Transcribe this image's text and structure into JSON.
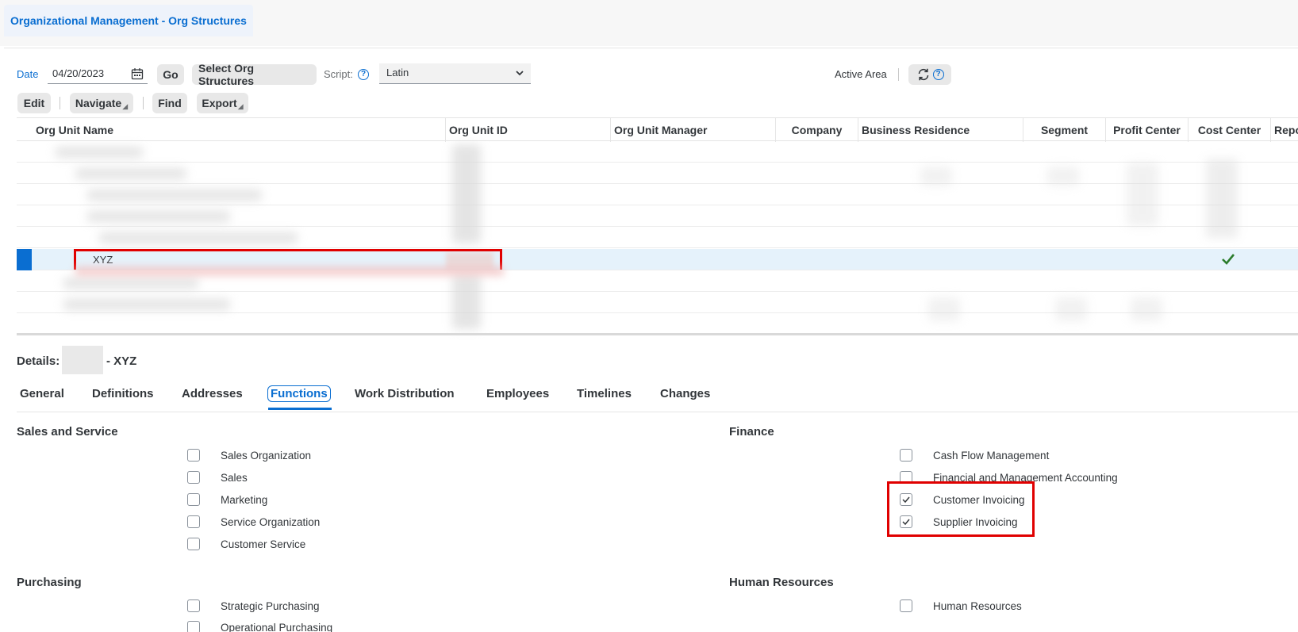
{
  "window": {
    "tab_title": "Organizational Management - Org Structures"
  },
  "toolbar": {
    "date_label": "Date",
    "date_value": "04/20/2023",
    "go_label": "Go",
    "select_org_label": "Select Org Structures",
    "script_label": "Script:",
    "script_value": "Latin",
    "active_area_label": "Active Area",
    "edit_label": "Edit",
    "navigate_label": "Navigate",
    "find_label": "Find",
    "export_label": "Export"
  },
  "table": {
    "columns": [
      "Org Unit Name",
      "Org Unit ID",
      "Org Unit Manager",
      "Company",
      "Business Residence",
      "Segment",
      "Profit Center",
      "Cost Center",
      "Repo"
    ],
    "selected_row": {
      "name": "XYZ",
      "cost_center_checked": true
    }
  },
  "details": {
    "label": "Details:",
    "name": "- XYZ"
  },
  "tabs": [
    "General",
    "Definitions",
    "Addresses",
    "Functions",
    "Work Distribution",
    "Employees",
    "Timelines",
    "Changes"
  ],
  "active_tab": "Functions",
  "sections": {
    "sales": {
      "title": "Sales and Service",
      "items": [
        {
          "label": "Sales Organization",
          "checked": false
        },
        {
          "label": "Sales",
          "checked": false
        },
        {
          "label": "Marketing",
          "checked": false
        },
        {
          "label": "Service Organization",
          "checked": false
        },
        {
          "label": "Customer Service",
          "checked": false
        }
      ]
    },
    "finance": {
      "title": "Finance",
      "items": [
        {
          "label": "Cash Flow Management",
          "checked": false
        },
        {
          "label": "Financial and Management Accounting",
          "checked": false
        },
        {
          "label": "Customer Invoicing",
          "checked": true
        },
        {
          "label": "Supplier Invoicing",
          "checked": true
        }
      ]
    },
    "purchasing": {
      "title": "Purchasing",
      "items": [
        {
          "label": "Strategic Purchasing",
          "checked": false
        },
        {
          "label": "Operational Purchasing",
          "checked": false
        }
      ]
    },
    "hr": {
      "title": "Human Resources",
      "items": [
        {
          "label": "Human Resources",
          "checked": false
        }
      ]
    }
  },
  "colors": {
    "accent": "#0a6ed1",
    "highlight_red": "#e00000",
    "check_green": "#2b7c2b"
  }
}
